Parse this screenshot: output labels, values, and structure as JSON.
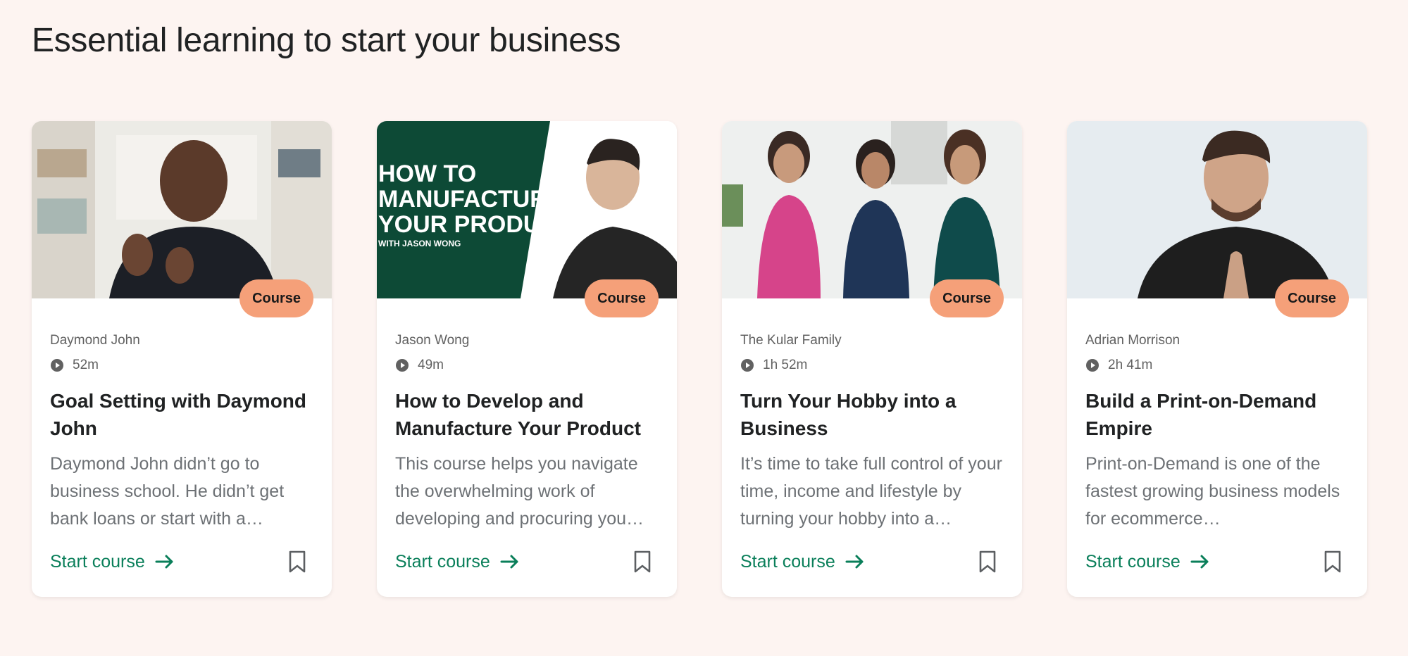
{
  "section": {
    "title": "Essential learning to start your business"
  },
  "colors": {
    "background": "#fdf4f1",
    "accent": "#0a7f5a",
    "badge": "#f5a079"
  },
  "cards": [
    {
      "badge": "Course",
      "author": "Daymond John",
      "duration": "52m",
      "title": "Goal Setting with Daymond John",
      "description": "Daymond John didn’t go to business school. He didn’t get bank loans or start with a…",
      "cta": "Start course",
      "icons": [
        "play-icon",
        "arrow-right-icon",
        "bookmark-icon"
      ]
    },
    {
      "badge": "Course",
      "author": "Jason Wong",
      "duration": "49m",
      "title": "How to Develop and Manufacture Your Product",
      "description": "This course helps you navigate the overwhelming work of developing and procuring you…",
      "cta": "Start course",
      "thumb_text": {
        "line1": "HOW TO",
        "line2": "MANUFACTURE",
        "line3": "YOUR PRODUCT",
        "line4": "WITH JASON WONG"
      },
      "icons": [
        "play-icon",
        "arrow-right-icon",
        "bookmark-icon"
      ]
    },
    {
      "badge": "Course",
      "author": "The Kular Family",
      "duration": "1h 52m",
      "title": "Turn Your Hobby into a Business",
      "description": "It’s time to take full control of your time, income and lifestyle by turning your hobby into a…",
      "cta": "Start course",
      "icons": [
        "play-icon",
        "arrow-right-icon",
        "bookmark-icon"
      ]
    },
    {
      "badge": "Course",
      "author": "Adrian Morrison",
      "duration": "2h 41m",
      "title": "Build a Print-on-Demand Empire",
      "description": "Print-on-Demand is one of the fastest growing business models for ecommerce…",
      "cta": "Start course",
      "icons": [
        "play-icon",
        "arrow-right-icon",
        "bookmark-icon"
      ]
    }
  ]
}
